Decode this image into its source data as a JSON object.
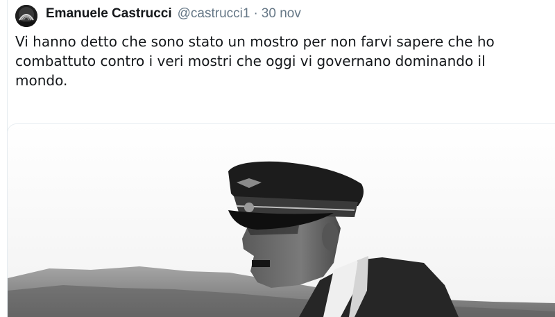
{
  "tweet": {
    "author_name": "Emanuele Castrucci",
    "handle": "@castrucci1",
    "separator": "·",
    "date": "30 nov",
    "text": "Vi hanno detto che sono stato un mostro per non farvi sapere che ho combattuto contro i veri mostri che oggi vi governano dominando il mondo."
  },
  "avatar": {
    "icon": "profile-avatar"
  },
  "media": {
    "type": "black-and-white photograph",
    "colors": {
      "sky": "#ffffff",
      "mountains": "#8c8c8c",
      "cap": "#1c1c1c",
      "coat": "#2a2a2a",
      "skin": "#6f6f6f"
    }
  }
}
